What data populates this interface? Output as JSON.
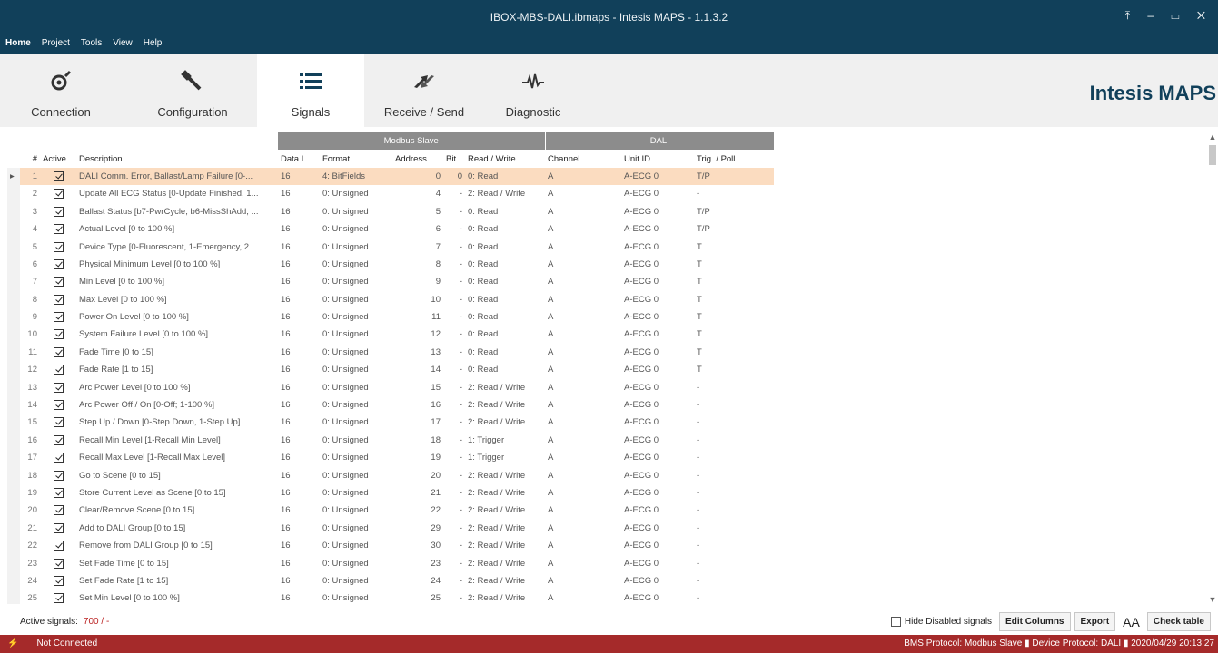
{
  "window": {
    "title": "IBOX-MBS-DALI.ibmaps - Intesis MAPS - 1.1.3.2",
    "controls": "⤒ – ▭ ✕"
  },
  "menu": [
    "Home",
    "Project",
    "Tools",
    "View",
    "Help"
  ],
  "ribbon": {
    "tabs": [
      {
        "label": "Connection",
        "icon": "connection-icon"
      },
      {
        "label": "Configuration",
        "icon": "wrench-icon"
      },
      {
        "label": "Signals",
        "icon": "list-icon"
      },
      {
        "label": "Receive / Send",
        "icon": "transfer-icon"
      },
      {
        "label": "Diagnostic",
        "icon": "pulse-icon"
      }
    ],
    "selected": "Signals",
    "brand": "Intesis MAPS"
  },
  "table": {
    "group_headers": {
      "modbus": "Modbus Slave",
      "dali": "DALI"
    },
    "columns": [
      "#",
      "Active",
      "Description",
      "Data L...",
      "Format",
      "Address...",
      "Bit",
      "Read / Write",
      "Channel",
      "Unit ID",
      "Trig. / Poll"
    ],
    "rows": [
      [
        "1",
        "DALI Comm. Error, Ballast/Lamp Failure [0-...",
        "16",
        "4: BitFields",
        "0",
        "0",
        "0: Read",
        "A",
        "A-ECG 0",
        "T/P"
      ],
      [
        "2",
        "Update All ECG Status [0-Update Finished, 1...",
        "16",
        "0: Unsigned",
        "4",
        "-",
        "2: Read / Write",
        "A",
        "A-ECG 0",
        "-"
      ],
      [
        "3",
        "Ballast Status [b7-PwrCycle, b6-MissShAdd, ...",
        "16",
        "0: Unsigned",
        "5",
        "-",
        "0: Read",
        "A",
        "A-ECG 0",
        "T/P"
      ],
      [
        "4",
        "Actual Level [0 to 100 %]",
        "16",
        "0: Unsigned",
        "6",
        "-",
        "0: Read",
        "A",
        "A-ECG 0",
        "T/P"
      ],
      [
        "5",
        "Device Type [0-Fluorescent, 1-Emergency, 2 ...",
        "16",
        "0: Unsigned",
        "7",
        "-",
        "0: Read",
        "A",
        "A-ECG 0",
        "T"
      ],
      [
        "6",
        "Physical Minimum Level [0 to 100 %]",
        "16",
        "0: Unsigned",
        "8",
        "-",
        "0: Read",
        "A",
        "A-ECG 0",
        "T"
      ],
      [
        "7",
        "Min Level [0 to 100 %]",
        "16",
        "0: Unsigned",
        "9",
        "-",
        "0: Read",
        "A",
        "A-ECG 0",
        "T"
      ],
      [
        "8",
        "Max Level [0 to 100 %]",
        "16",
        "0: Unsigned",
        "10",
        "-",
        "0: Read",
        "A",
        "A-ECG 0",
        "T"
      ],
      [
        "9",
        "Power On Level [0 to 100 %]",
        "16",
        "0: Unsigned",
        "11",
        "-",
        "0: Read",
        "A",
        "A-ECG 0",
        "T"
      ],
      [
        "10",
        "System Failure Level [0 to 100 %]",
        "16",
        "0: Unsigned",
        "12",
        "-",
        "0: Read",
        "A",
        "A-ECG 0",
        "T"
      ],
      [
        "11",
        "Fade Time [0 to 15]",
        "16",
        "0: Unsigned",
        "13",
        "-",
        "0: Read",
        "A",
        "A-ECG 0",
        "T"
      ],
      [
        "12",
        "Fade Rate [1 to 15]",
        "16",
        "0: Unsigned",
        "14",
        "-",
        "0: Read",
        "A",
        "A-ECG 0",
        "T"
      ],
      [
        "13",
        "Arc Power Level [0 to 100 %]",
        "16",
        "0: Unsigned",
        "15",
        "-",
        "2: Read / Write",
        "A",
        "A-ECG 0",
        "-"
      ],
      [
        "14",
        "Arc Power Off / On [0-Off; 1-100 %]",
        "16",
        "0: Unsigned",
        "16",
        "-",
        "2: Read / Write",
        "A",
        "A-ECG 0",
        "-"
      ],
      [
        "15",
        "Step Up / Down [0-Step Down, 1-Step Up]",
        "16",
        "0: Unsigned",
        "17",
        "-",
        "2: Read / Write",
        "A",
        "A-ECG 0",
        "-"
      ],
      [
        "16",
        "Recall Min Level [1-Recall Min Level]",
        "16",
        "0: Unsigned",
        "18",
        "-",
        "1: Trigger",
        "A",
        "A-ECG 0",
        "-"
      ],
      [
        "17",
        "Recall Max Level [1-Recall Max Level]",
        "16",
        "0: Unsigned",
        "19",
        "-",
        "1: Trigger",
        "A",
        "A-ECG 0",
        "-"
      ],
      [
        "18",
        "Go to Scene [0 to 15]",
        "16",
        "0: Unsigned",
        "20",
        "-",
        "2: Read / Write",
        "A",
        "A-ECG 0",
        "-"
      ],
      [
        "19",
        "Store Current Level as Scene [0 to 15]",
        "16",
        "0: Unsigned",
        "21",
        "-",
        "2: Read / Write",
        "A",
        "A-ECG 0",
        "-"
      ],
      [
        "20",
        "Clear/Remove Scene [0 to 15]",
        "16",
        "0: Unsigned",
        "22",
        "-",
        "2: Read / Write",
        "A",
        "A-ECG 0",
        "-"
      ],
      [
        "21",
        "Add to DALI Group [0 to 15]",
        "16",
        "0: Unsigned",
        "29",
        "-",
        "2: Read / Write",
        "A",
        "A-ECG 0",
        "-"
      ],
      [
        "22",
        "Remove from DALI Group [0 to 15]",
        "16",
        "0: Unsigned",
        "30",
        "-",
        "2: Read / Write",
        "A",
        "A-ECG 0",
        "-"
      ],
      [
        "23",
        "Set Fade Time [0 to 15]",
        "16",
        "0: Unsigned",
        "23",
        "-",
        "2: Read / Write",
        "A",
        "A-ECG 0",
        "-"
      ],
      [
        "24",
        "Set Fade Rate [1 to 15]",
        "16",
        "0: Unsigned",
        "24",
        "-",
        "2: Read / Write",
        "A",
        "A-ECG 0",
        "-"
      ],
      [
        "25",
        "Set Min Level [0 to 100 %]",
        "16",
        "0: Unsigned",
        "25",
        "-",
        "2: Read / Write",
        "A",
        "A-ECG 0",
        "-"
      ]
    ]
  },
  "footer": {
    "active_label": "Active signals:",
    "active_value": "700 / -",
    "hide_label": "Hide Disabled signals",
    "edit_columns": "Edit Columns",
    "export": "Export",
    "font_size": "AA",
    "check_table": "Check table"
  },
  "status": {
    "connection": "Not Connected",
    "info": "BMS Protocol: Modbus Slave  ▮  Device Protocol: DALI  ▮  2020/04/29 20:13:27"
  },
  "colors": {
    "titlebar": "#11405a",
    "selected_row": "#fbdcc0",
    "status_bar": "#a52a2a"
  }
}
